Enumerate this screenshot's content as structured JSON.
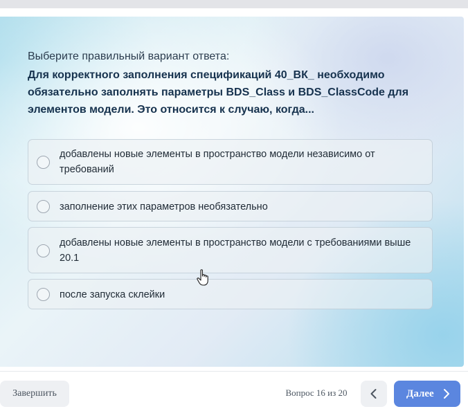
{
  "quiz": {
    "prompt": "Выберите правильный вариант ответа:",
    "question": "Для корректного заполнения спецификаций 40_ВК_ необходимо обязательно заполнять параметры BDS_Class и BDS_ClassCode для элементов модели. Это относится к случаю, когда...",
    "options": [
      {
        "label": "добавлены новые элементы в пространство модели независимо от требований",
        "selected": false
      },
      {
        "label": "заполнение этих параметров необязательно",
        "selected": false
      },
      {
        "label": "добавлены новые элементы в пространство модели с требованиями выше 20.1",
        "selected": false
      },
      {
        "label": "после запуска склейки",
        "selected": false
      }
    ]
  },
  "footer": {
    "finish_label": "Завершить",
    "progress_text": "Вопрос 16 из 20",
    "prev_icon": "chevron-left-icon",
    "next_label": "Далее",
    "next_icon": "chevron-right-icon"
  },
  "colors": {
    "accent": "#5b86df",
    "question_text": "#16324e",
    "secondary_button": "#eef0f3"
  }
}
